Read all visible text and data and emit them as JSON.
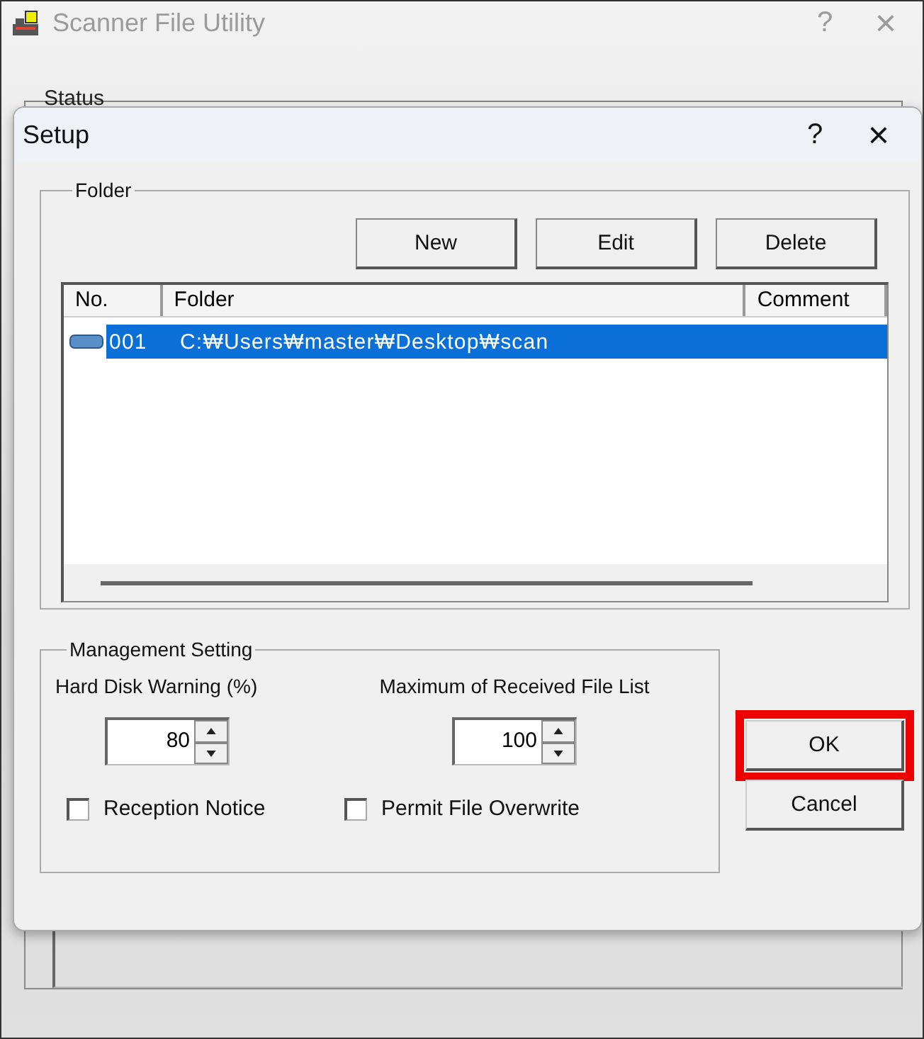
{
  "main_window": {
    "title": "Scanner File Utility",
    "help": "?",
    "close": "×",
    "status_label": "Status"
  },
  "dialog": {
    "title": "Setup",
    "help": "?",
    "close": "×",
    "folder_group": {
      "label": "Folder",
      "buttons": [
        "New",
        "Edit",
        "Delete"
      ],
      "columns": [
        "No.",
        "Folder",
        "Comment"
      ],
      "rows": [
        {
          "no": "001",
          "folder": "C:₩Users₩master₩Desktop₩scan",
          "selected": true
        }
      ]
    },
    "management": {
      "label": "Management Setting",
      "spinners": [
        {
          "label": "Hard Disk Warning (%)",
          "value": "80"
        },
        {
          "label": "Maximum of Received File List",
          "value": "100"
        }
      ],
      "checkboxes": [
        {
          "label": "Reception Notice",
          "checked": false
        },
        {
          "label": "Permit File Overwrite",
          "checked": false
        }
      ]
    },
    "buttons": [
      {
        "label": "OK",
        "highlighted": true
      },
      {
        "label": "Cancel",
        "highlighted": false
      }
    ]
  }
}
